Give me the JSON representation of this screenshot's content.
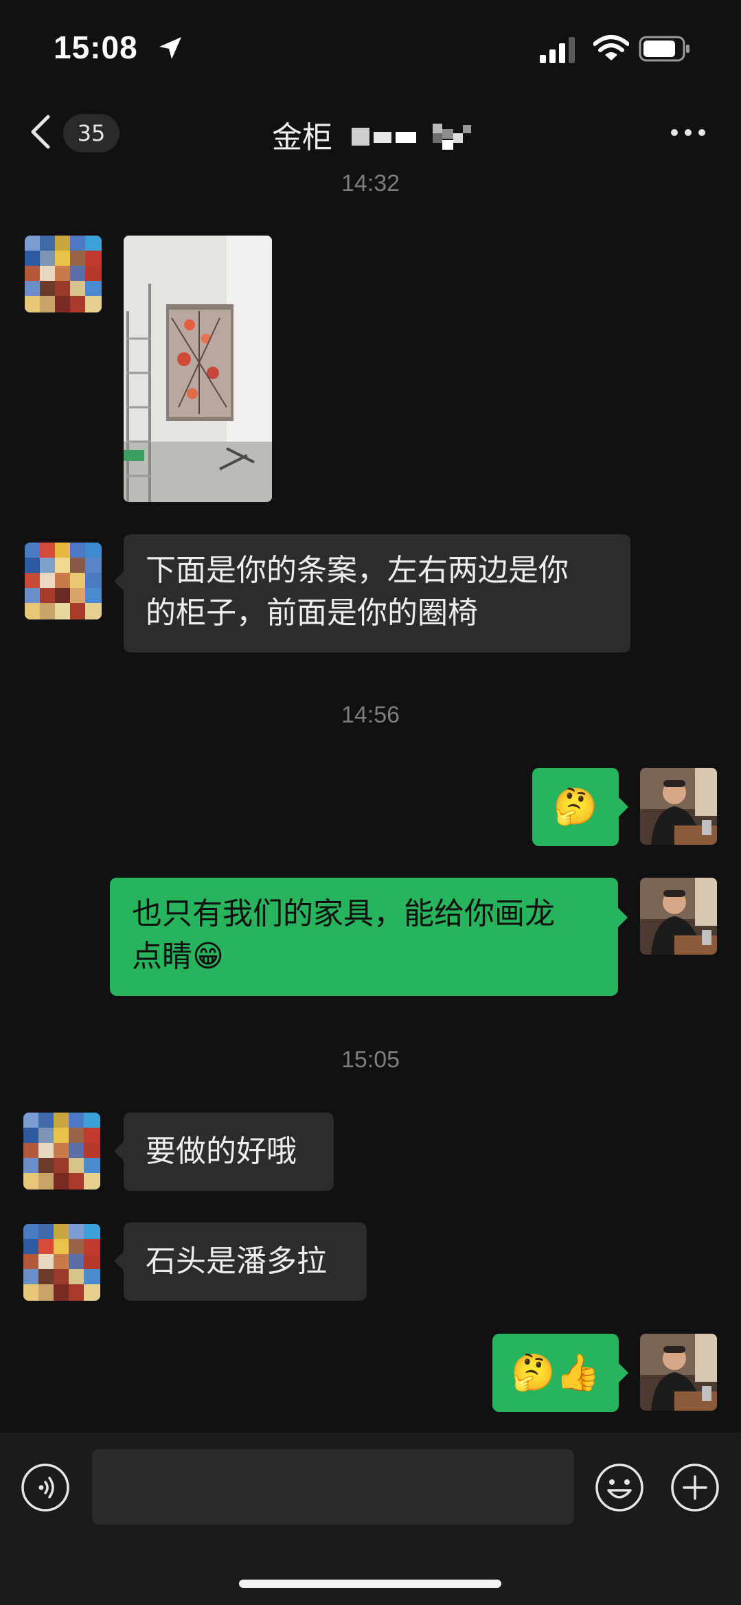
{
  "status_bar": {
    "time": "15:08"
  },
  "nav": {
    "back_badge": "35",
    "title": "金柜"
  },
  "messages": [
    {
      "type": "timestamp",
      "text": "14:32"
    },
    {
      "type": "image",
      "from": "other"
    },
    {
      "type": "text",
      "from": "other",
      "lines": [
        "下面是你的条案，左右两边是你",
        "的柜子，前面是你的圈椅"
      ]
    },
    {
      "type": "timestamp",
      "text": "14:56"
    },
    {
      "type": "emoji",
      "from": "me",
      "text": "🤔"
    },
    {
      "type": "text",
      "from": "me",
      "lines": [
        "也只有我们的家具，能给你画龙",
        "点睛😁"
      ]
    },
    {
      "type": "timestamp",
      "text": "15:05"
    },
    {
      "type": "text",
      "from": "other",
      "lines": [
        "要做的好哦"
      ]
    },
    {
      "type": "text",
      "from": "other",
      "lines": [
        "石头是潘多拉"
      ]
    },
    {
      "type": "emoji",
      "from": "me",
      "text": "🤔👍"
    }
  ],
  "colors": {
    "background": "#111111",
    "incoming_bubble": "#2c2c2c",
    "outgoing_bubble": "#27b45c"
  },
  "icons": [
    "location-arrow-icon",
    "signal-icon",
    "wifi-icon",
    "battery-icon",
    "back-chevron-icon",
    "more-icon",
    "voice-icon",
    "emoji-icon",
    "plus-icon"
  ]
}
